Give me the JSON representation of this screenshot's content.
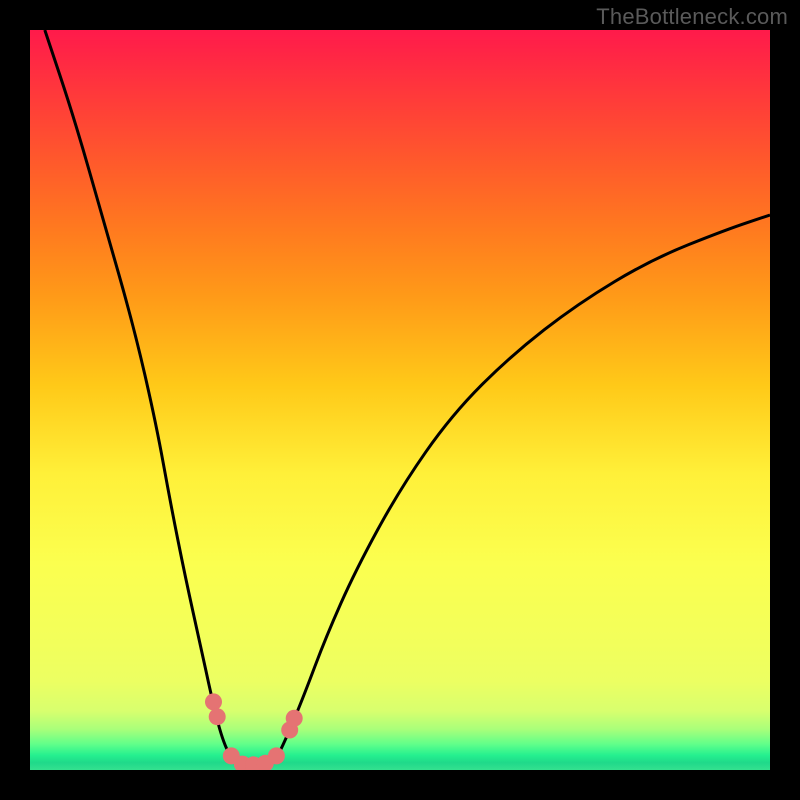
{
  "watermark": "TheBottleneck.com",
  "chart_data": {
    "type": "line",
    "title": "",
    "xlabel": "",
    "ylabel": "",
    "xlim": [
      0,
      100
    ],
    "ylim": [
      0,
      100
    ],
    "grid": false,
    "curve_points": [
      {
        "x": 2,
        "y": 100
      },
      {
        "x": 6,
        "y": 88
      },
      {
        "x": 10,
        "y": 74
      },
      {
        "x": 14,
        "y": 60
      },
      {
        "x": 17,
        "y": 47
      },
      {
        "x": 19,
        "y": 36
      },
      {
        "x": 21,
        "y": 26
      },
      {
        "x": 23,
        "y": 17
      },
      {
        "x": 24.5,
        "y": 10
      },
      {
        "x": 26,
        "y": 4
      },
      {
        "x": 27.5,
        "y": 1
      },
      {
        "x": 29.5,
        "y": 0
      },
      {
        "x": 31,
        "y": 0
      },
      {
        "x": 33,
        "y": 1
      },
      {
        "x": 34.5,
        "y": 4
      },
      {
        "x": 37,
        "y": 10
      },
      {
        "x": 40,
        "y": 18
      },
      {
        "x": 44,
        "y": 27
      },
      {
        "x": 50,
        "y": 38
      },
      {
        "x": 57,
        "y": 48
      },
      {
        "x": 65,
        "y": 56
      },
      {
        "x": 74,
        "y": 63
      },
      {
        "x": 84,
        "y": 69
      },
      {
        "x": 94,
        "y": 73
      },
      {
        "x": 100,
        "y": 75
      }
    ],
    "markers": [
      {
        "x": 24.8,
        "y": 9.2
      },
      {
        "x": 25.3,
        "y": 7.2
      },
      {
        "x": 27.2,
        "y": 1.9
      },
      {
        "x": 28.7,
        "y": 0.8
      },
      {
        "x": 30.2,
        "y": 0.7
      },
      {
        "x": 31.8,
        "y": 0.9
      },
      {
        "x": 33.3,
        "y": 1.9
      },
      {
        "x": 35.1,
        "y": 5.4
      },
      {
        "x": 35.7,
        "y": 7.0
      }
    ],
    "marker_color": "#e57373",
    "gradient_stops": [
      {
        "pos": 0,
        "color": "#ff1a4b"
      },
      {
        "pos": 0.38,
        "color": "#ff9a18"
      },
      {
        "pos": 0.62,
        "color": "#fff039"
      },
      {
        "pos": 0.9,
        "color": "#ecff62"
      },
      {
        "pos": 0.965,
        "color": "#61ff8a"
      },
      {
        "pos": 1.0,
        "color": "#35e18f"
      }
    ]
  }
}
